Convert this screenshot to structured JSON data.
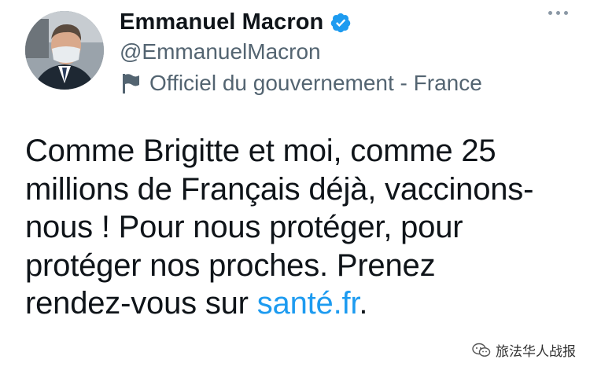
{
  "tweet": {
    "display_name": "Emmanuel Macron",
    "handle": "@EmmanuelMacron",
    "account_label": "Officiel du gouvernement - France",
    "text_lines": [
      "Comme Brigitte et moi, comme 25",
      "millions de Français déjà, vaccinons-",
      "nous ! Pour nous protéger, pour",
      "protéger nos proches. Prenez",
      "rendez-vous sur "
    ],
    "link_text": "santé.fr",
    "after_link": ".",
    "verified_color": "#1d9bf0",
    "link_color": "#1d9bf0"
  },
  "watermark": {
    "text": "旅法华人战报"
  }
}
